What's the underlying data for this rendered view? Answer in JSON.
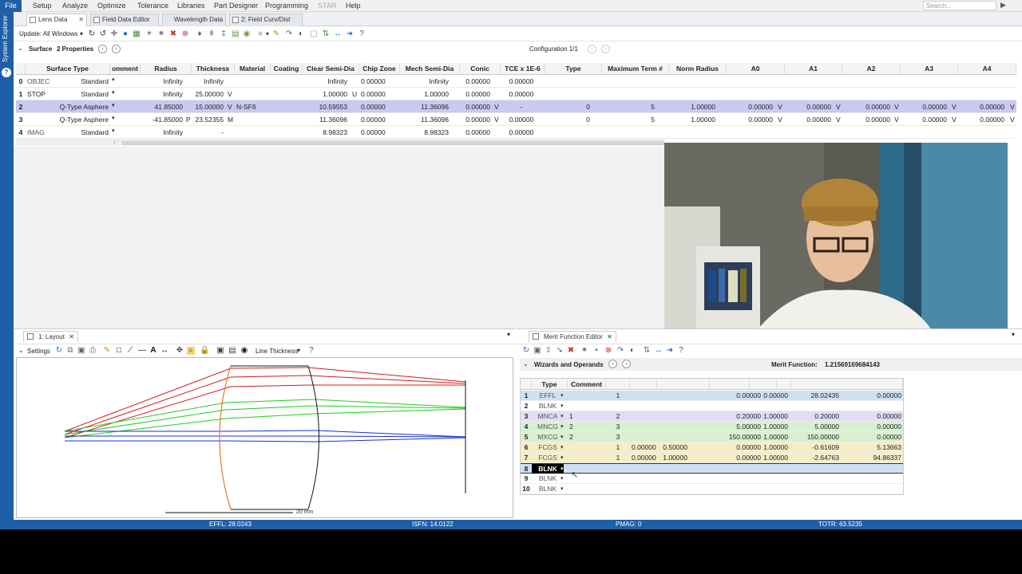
{
  "menu": {
    "file": "File",
    "items": [
      "Setup",
      "Analyze",
      "Optimize",
      "Tolerance",
      "Libraries",
      "Part Designer",
      "Programming",
      "STAR",
      "Help"
    ],
    "search_placeholder": "Search..."
  },
  "system_explorer_label": "System Explorer",
  "tabs": [
    "Lens Data",
    "Field Data Editor",
    "Wavelength Data",
    "2: Field Curv/Dist"
  ],
  "toolbar": {
    "update_label": "Update: All Windows"
  },
  "surface_bar": {
    "label": "Surface",
    "properties": "2 Properties",
    "configuration": "Configuration 1/1"
  },
  "lens_data": {
    "headers": [
      "Surface Type",
      "omment",
      "Radius",
      "Thickness",
      "Material",
      "Coating",
      "Clear Semi-Dia",
      "Chip Zone",
      "Mech Semi-Dia",
      "Conic",
      "TCE x 1E-6",
      "Type",
      "Maximum Term #",
      "Norm Radius",
      "A0",
      "A1",
      "A2",
      "A3",
      "A4"
    ],
    "rows": [
      {
        "num": "0",
        "name": "OBJEC",
        "type": "Standard",
        "radius": "Infinity",
        "thickness": "Infinity",
        "th_flag": "",
        "material": "",
        "clear": "Infinity",
        "chip": "0.00000",
        "mech": "Infinity",
        "conic": "0.00000",
        "conic_flag": "",
        "tce": "0.00000",
        "qtype": "",
        "maxterm": "",
        "norm": "",
        "a0": "",
        "a1": "",
        "a2": "",
        "a3": "",
        "a4": ""
      },
      {
        "num": "1",
        "name": "STOP",
        "type": "Standard",
        "radius": "Infinity",
        "thickness": "25.00000",
        "th_flag": "V",
        "material": "",
        "clear": "1.00000",
        "clear_flag": "U",
        "chip": "0.00000",
        "mech": "1.00000",
        "conic": "0.00000",
        "conic_flag": "",
        "tce": "0.00000",
        "qtype": "",
        "maxterm": "",
        "norm": "",
        "a0": "",
        "a1": "",
        "a2": "",
        "a3": "",
        "a4": ""
      },
      {
        "num": "2",
        "name": "",
        "type": "Q-Type Asphere",
        "radius": "41.85000",
        "thickness": "15.00000",
        "th_flag": "V",
        "material": "N-SF6",
        "clear": "10.59553",
        "chip": "0.00000",
        "mech": "11.36096",
        "conic": "0.00000",
        "conic_flag": "V",
        "tce": "-",
        "qtype": "0",
        "maxterm": "5",
        "norm": "1.00000",
        "a0": "0.00000",
        "a1": "0.00000",
        "a2": "0.00000",
        "a3": "0.00000",
        "a4": "0.00000"
      },
      {
        "num": "3",
        "name": "",
        "type": "Q-Type Asphere",
        "radius": "-41.85000",
        "radius_flag": "P",
        "thickness": "23.52355",
        "th_flag": "M",
        "material": "",
        "clear": "11.36096",
        "chip": "0.00000",
        "mech": "11.36096",
        "conic": "0.00000",
        "conic_flag": "V",
        "tce": "0.00000",
        "qtype": "0",
        "maxterm": "5",
        "norm": "1.00000",
        "a0": "0.00000",
        "a1": "0.00000",
        "a2": "0.00000",
        "a3": "0.00000",
        "a4": "0.00000"
      },
      {
        "num": "4",
        "name": "IMAG",
        "type": "Standard",
        "radius": "Infinity",
        "thickness": "-",
        "th_flag": "",
        "material": "",
        "clear": "8.98323",
        "chip": "0.00000",
        "mech": "8.98323",
        "conic": "0.00000",
        "conic_flag": "",
        "tce": "0.00000",
        "qtype": "",
        "maxterm": "",
        "norm": "",
        "a0": "",
        "a1": "",
        "a2": "",
        "a3": "",
        "a4": ""
      }
    ]
  },
  "layout": {
    "tab": "1: Layout",
    "settings": "Settings",
    "line_thickness": "Line Thickness",
    "scale": "20 mm"
  },
  "merit": {
    "tab": "Merit Function Editor",
    "wizards": "Wizards and Operands",
    "mf_label": "Merit Function:",
    "mf_value": "1.21569169684143",
    "headers": [
      "Type",
      "Comment"
    ],
    "rows": [
      {
        "n": "1",
        "type": "EFFL",
        "c1": "",
        "c2": "1",
        "c3": "",
        "c4": "",
        "v1": "0.00000",
        "v2": "0.00000",
        "v3": "28.02435",
        "v4": "0.00000",
        "color": "#cfe0f3"
      },
      {
        "n": "2",
        "type": "BLNK",
        "c1": "",
        "c2": "",
        "c3": "",
        "c4": "",
        "v1": "",
        "v2": "",
        "v3": "",
        "v4": "",
        "color": "#ffffff"
      },
      {
        "n": "3",
        "type": "MNCA",
        "c1": "1",
        "c2": "2",
        "c3": "",
        "c4": "",
        "v1": "0.20000",
        "v2": "1.00000",
        "v3": "0.20000",
        "v4": "0.00000",
        "color": "#e3dcf5"
      },
      {
        "n": "4",
        "type": "MNCG",
        "c1": "2",
        "c2": "3",
        "c3": "",
        "c4": "",
        "v1": "5.00000",
        "v2": "1.00000",
        "v3": "5.00000",
        "v4": "0.00000",
        "color": "#d8f0d0"
      },
      {
        "n": "5",
        "type": "MXCG",
        "c1": "2",
        "c2": "3",
        "c3": "",
        "c4": "",
        "v1": "150.00000",
        "v2": "1.00000",
        "v3": "150.00000",
        "v4": "0.00000",
        "color": "#d8f0d0"
      },
      {
        "n": "6",
        "type": "FCGS",
        "c1": "",
        "c2": "1",
        "c3": "0.00000",
        "c4": "0.50000",
        "v1": "0.00000",
        "v2": "1.00000",
        "v3": "-0.61609",
        "v4": "5.13663",
        "color": "#f6edc5"
      },
      {
        "n": "7",
        "type": "FCGS",
        "c1": "",
        "c2": "1",
        "c3": "0.00000",
        "c4": "1.00000",
        "v1": "0.00000",
        "v2": "1.00000",
        "v3": "-2.64763",
        "v4": "94.86337",
        "color": "#f6edc5"
      },
      {
        "n": "8",
        "type": "BLNK",
        "c1": "",
        "c2": "",
        "c3": "",
        "c4": "",
        "v1": "",
        "v2": "",
        "v3": "",
        "v4": "",
        "color": "#cfe0f3"
      },
      {
        "n": "9",
        "type": "BLNK",
        "c1": "",
        "c2": "",
        "c3": "",
        "c4": "",
        "v1": "",
        "v2": "",
        "v3": "",
        "v4": "",
        "color": "#ffffff"
      },
      {
        "n": "10",
        "type": "BLNK",
        "c1": "",
        "c2": "",
        "c3": "",
        "c4": "",
        "v1": "",
        "v2": "",
        "v3": "",
        "v4": "",
        "color": "#ffffff"
      }
    ]
  },
  "status": {
    "effl": "EFFL: 28.0243",
    "isfn": "ISFN: 14.0122",
    "pmag": "PMAG: 0",
    "totr": "TOTR: 63.5235"
  },
  "colors": {
    "accent": "#1f5fa8",
    "ray_red": "#d11b1b",
    "ray_green": "#1fcc1f",
    "ray_blue": "#1a2fd0",
    "lens_front": "#e07a2a"
  }
}
